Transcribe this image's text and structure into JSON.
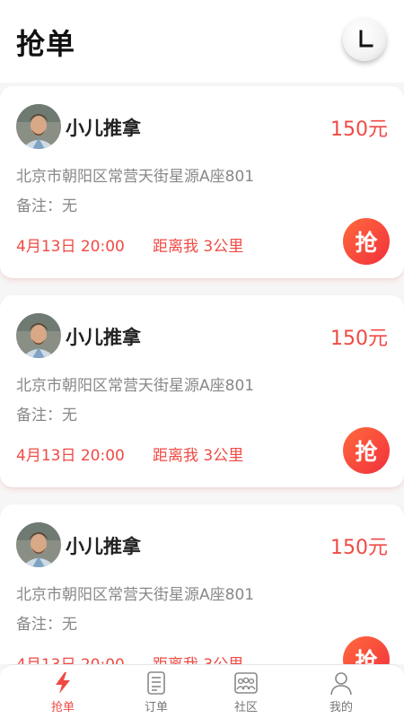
{
  "header": {
    "title": "抢单",
    "history_icon": "clock-icon"
  },
  "orders": [
    {
      "customer": "小儿推拿",
      "price": "150元",
      "address": "北京市朝阳区常营天街星源A座801",
      "note_label": "备注：",
      "note_value": "无",
      "time": "4月13日 20:00",
      "distance_label": "距离我",
      "distance_value": "3公里",
      "grab_label": "抢"
    },
    {
      "customer": "小儿推拿",
      "price": "150元",
      "address": "北京市朝阳区常营天街星源A座801",
      "note_label": "备注：",
      "note_value": "无",
      "time": "4月13日 20:00",
      "distance_label": "距离我",
      "distance_value": "3公里",
      "grab_label": "抢"
    },
    {
      "customer": "小儿推拿",
      "price": "150元",
      "address": "北京市朝阳区常营天街星源A座801",
      "note_label": "备注：",
      "note_value": "无",
      "time": "4月13日 20:00",
      "distance_label": "距离我",
      "distance_value": "3公里",
      "grab_label": "抢"
    }
  ],
  "tabbar": {
    "items": [
      {
        "label": "抢单",
        "icon": "lightning-icon",
        "active": true
      },
      {
        "label": "订单",
        "icon": "document-icon",
        "active": false
      },
      {
        "label": "社区",
        "icon": "community-icon",
        "active": false
      },
      {
        "label": "我的",
        "icon": "person-icon",
        "active": false
      }
    ]
  },
  "colors": {
    "accent": "#f04a44",
    "grab_gradient_start": "#ff6a3d",
    "grab_gradient_end": "#f2303c"
  }
}
